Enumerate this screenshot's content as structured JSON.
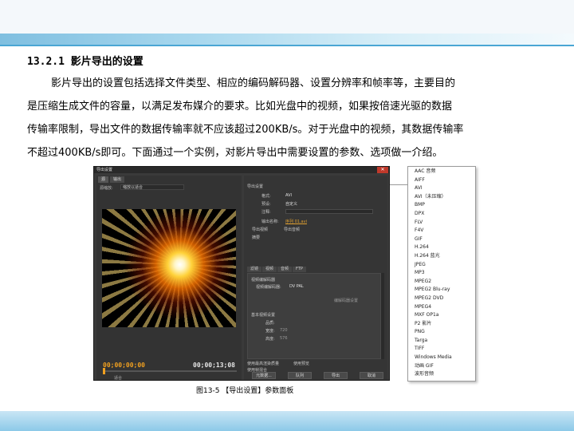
{
  "section": {
    "title": "13.2.1 影片导出的设置"
  },
  "paragraph": {
    "line1": "影片导出的设置包括选择文件类型、相应的编码解码器、设置分辨率和帧率等，主要目的",
    "line2": "是压缩生成文件的容量，以满足发布媒介的要求。比如光盘中的视频，如果按倍速光驱的数据",
    "line3": "传输率限制，导出文件的数据传输率就不应该超过200KB/s。对于光盘中的视频，其数据传输率",
    "line4": "不超过400KB/s即可。下面通过一个实例，对影片导出中需要设置的参数、选项做一介绍。"
  },
  "dialog": {
    "title": "导出设置",
    "close_glyph": "✕",
    "tabs": [
      "源",
      "输出"
    ],
    "source_label": "源缩放:",
    "source_value": "缩放以适合",
    "timecode_start": "00;00;00;00",
    "timecode_end": "00;00;13;08",
    "zoom_label": "适合",
    "export_settings_heading": "导出设置",
    "format_label": "格式:",
    "format_value": "AVI",
    "preset_label": "预设:",
    "preset_value": "自定义",
    "comments_label": "注释:",
    "output_name_label": "输出名称:",
    "output_name_value": "序列 01.avi",
    "export_video_label": "导出视频",
    "export_audio_label": "导出音频",
    "summary_label": "摘要",
    "settings_tabs": [
      "滤镜",
      "视频",
      "音频",
      "FTP"
    ],
    "codec_heading": "视频编解码器",
    "codec_label": "视频编解码器:",
    "codec_value": "DV PAL",
    "codec_settings_button": "编解码器设置",
    "basic_heading": "基本视频设置",
    "quality_label": "品质:",
    "width_label": "宽度:",
    "width_value": "720",
    "height_label": "高度:",
    "height_value": "576",
    "max_depth_label": "使用最高渲染质量",
    "use_previews_label": "使用预览",
    "use_frame_blend_label": "使用帧混合",
    "buttons": [
      "元数据...",
      "队列",
      "导出",
      "取消"
    ]
  },
  "format_list": {
    "items": [
      "AAC 音频",
      "AIFF",
      "AVI",
      "AVI（未压缩）",
      "BMP",
      "DPX",
      "FLV",
      "F4V",
      "GIF",
      "H.264",
      "H.264 蓝光",
      "JPEG",
      "MP3",
      "MPEG2",
      "MPEG2 Blu-ray",
      "MPEG2 DVD",
      "MPEG4",
      "MXF OP1a",
      "P2 影片",
      "PNG",
      "Targa",
      "TIFF",
      "Windows Media",
      "动画 GIF",
      "波形音频"
    ],
    "selected_index": 2,
    "check_glyph": "●"
  },
  "caption": "图13-5 【导出设置】参数面板",
  "colors": {
    "accent_bar": "#4aa6d4",
    "timecode": "#f0a020"
  }
}
